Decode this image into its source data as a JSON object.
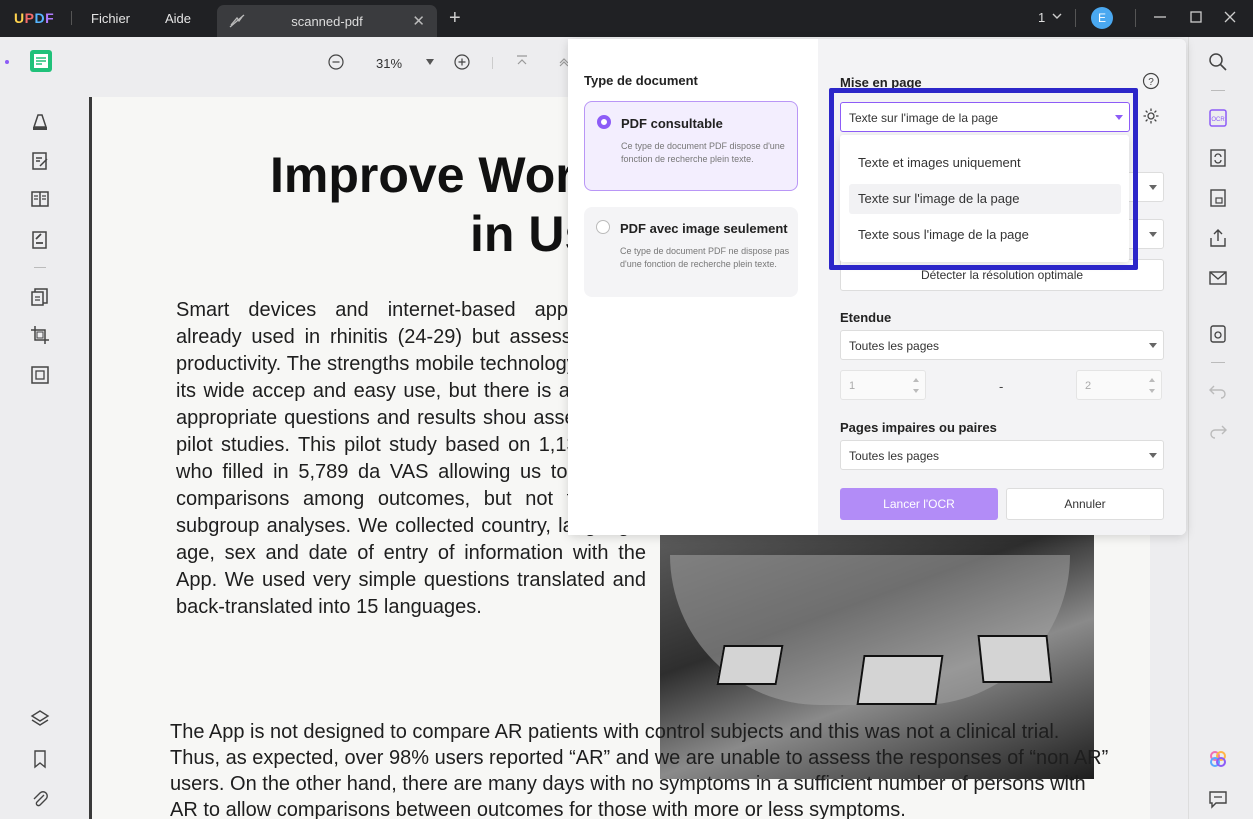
{
  "app": {
    "logo": "UPDF",
    "menus": [
      "Fichier",
      "Aide"
    ],
    "tab_title": "scanned-pdf",
    "page_number": "1",
    "avatar_letter": "E"
  },
  "toolbar": {
    "zoom": "31%"
  },
  "document": {
    "headline_line1": "Improve Wor",
    "headline_line2": "in Us",
    "paragraph1": "Smart devices and internet-based applica are already used in rhinitis (24-29) but assessed work productivity. The strengths mobile technology include its wide accep and easy use, but there is a need to appropriate questions and results shou assessed by pilot studies. This pilot study based on 1,136 users who filled in 5,789 da VAS allowing us to perform comparisons among outcomes, but not to make subgroup analyses. We collected country, language, age, sex and date of entry of information with the App. We used very simple questions translated and back-translated into 15 languages.",
    "paragraph2": "The App is not designed to compare AR patients with control subjects and this was not a clinical trial. Thus, as expected, over 98% users reported “AR” and we are unable to assess the responses of “non AR” users. On the other hand, there are many days with no symptoms in a sufficient number of persons with AR to allow comparisons between outcomes for those with more or less symptoms."
  },
  "ocr_dialog": {
    "doc_type_title": "Type de document",
    "option1_title": "PDF consultable",
    "option1_desc": "Ce type de document PDF dispose d'une fonction de recherche plein texte.",
    "option2_title": "PDF avec image seulement",
    "option2_desc": "Ce type de document PDF ne dispose pas d'une fonction de recherche plein texte.",
    "layout_title": "Mise en page",
    "layout_value": "Texte sur l'image de la page",
    "layout_options": [
      "Texte et images uniquement",
      "Texte sur l'image de la page",
      "Texte sous l'image de la page"
    ],
    "detect_button": "Détecter la résolution optimale",
    "range_title": "Etendue",
    "range_value": "Toutes les pages",
    "range_from": "1",
    "range_to": "2",
    "range_dash": "-",
    "parity_title": "Pages impaires ou paires",
    "parity_value": "Toutes les pages",
    "run_button": "Lancer l'OCR",
    "cancel_button": "Annuler"
  },
  "colors": {
    "accent": "#8d5cf7",
    "highlight": "#2c26c9"
  }
}
